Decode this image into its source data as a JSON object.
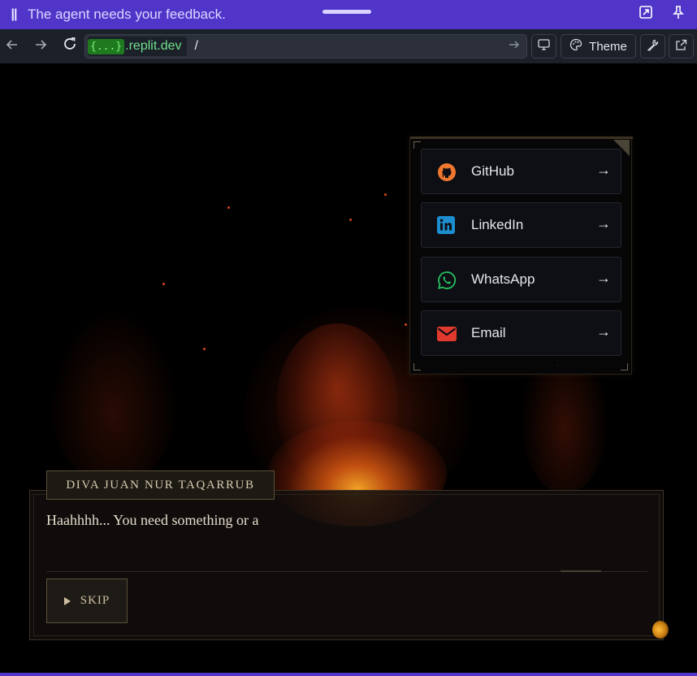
{
  "agent_bar": {
    "pause_icon": "pause-icon",
    "message": "The agent needs your feedback.",
    "expand_icon": "expand-icon",
    "pin_icon": "pin-icon",
    "color": "#5135c9"
  },
  "browser": {
    "back_icon": "arrow-left-icon",
    "forward_icon": "arrow-right-icon",
    "reload_icon": "reload-icon",
    "url_tag": "{...}",
    "url_domain": ".replit.dev",
    "url_path": "/",
    "go_icon": "arrow-right-icon",
    "device_icon": "monitor-icon",
    "theme_label": "Theme",
    "theme_icon": "palette-icon",
    "devtools_icon": "wrench-icon",
    "open_external_icon": "external-link-icon"
  },
  "social": {
    "links": [
      {
        "label": "GitHub",
        "icon": "github-icon",
        "arrow": "→",
        "color": "#f0772f"
      },
      {
        "label": "LinkedIn",
        "icon": "linkedin-icon",
        "arrow": "→",
        "color": "#1d8fd1"
      },
      {
        "label": "WhatsApp",
        "icon": "whatsapp-icon",
        "arrow": "→",
        "color": "#25c260"
      },
      {
        "label": "Email",
        "icon": "mail-icon",
        "arrow": "→",
        "color": "#e0392e"
      }
    ]
  },
  "dialog": {
    "speaker": "DIVA JUAN NUR TAQARRUB",
    "text": "Haahhhh... You need something or a",
    "skip_label": "SKIP",
    "skip_icon": "play-icon"
  }
}
